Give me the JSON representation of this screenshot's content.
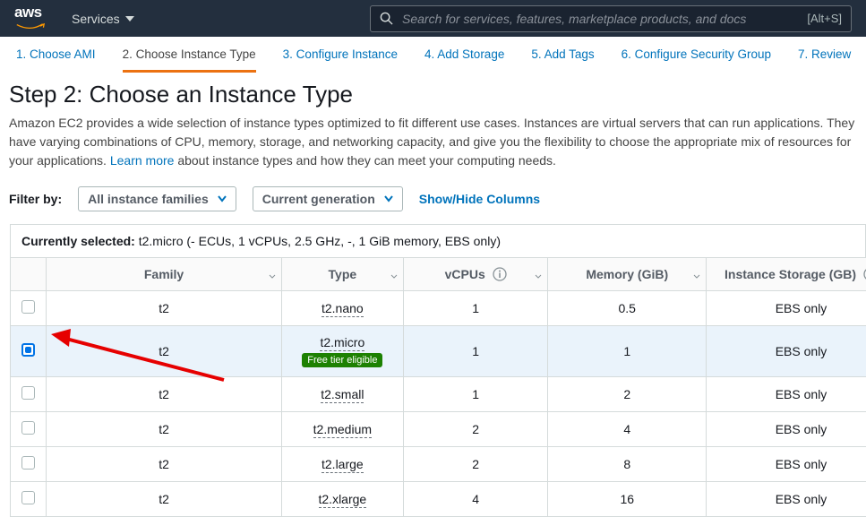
{
  "header": {
    "services_label": "Services",
    "search_placeholder": "Search for services, features, marketplace products, and docs",
    "shortcut": "[Alt+S]"
  },
  "wizard": [
    {
      "label": "1. Choose AMI",
      "active": false
    },
    {
      "label": "2. Choose Instance Type",
      "active": true
    },
    {
      "label": "3. Configure Instance",
      "active": false
    },
    {
      "label": "4. Add Storage",
      "active": false
    },
    {
      "label": "5. Add Tags",
      "active": false
    },
    {
      "label": "6. Configure Security Group",
      "active": false
    },
    {
      "label": "7. Review",
      "active": false
    }
  ],
  "page": {
    "title": "Step 2: Choose an Instance Type",
    "desc_a": "Amazon EC2 provides a wide selection of instance types optimized to fit different use cases. Instances are virtual servers that can run applications. They have varying combinations of CPU, memory, storage, and networking capacity, and give you the flexibility to choose the appropriate mix of resources for your applications. ",
    "learn_more": "Learn more",
    "desc_b": " about instance types and how they can meet your computing needs."
  },
  "filters": {
    "label": "Filter by:",
    "family": "All instance families",
    "generation": "Current generation",
    "columns_link": "Show/Hide Columns"
  },
  "selection": {
    "label": "Currently selected:",
    "value": "t2.micro (- ECUs, 1 vCPUs, 2.5 GHz, -, 1 GiB memory, EBS only)"
  },
  "columns": {
    "family": "Family",
    "type": "Type",
    "vcpus": "vCPUs",
    "memory": "Memory (GiB)",
    "storage": "Instance Storage (GB)"
  },
  "free_tier_badge": "Free tier eligible",
  "rows": [
    {
      "selected": false,
      "family": "t2",
      "type": "t2.nano",
      "vcpus": "1",
      "memory": "0.5",
      "storage": "EBS only",
      "free": false
    },
    {
      "selected": true,
      "family": "t2",
      "type": "t2.micro",
      "vcpus": "1",
      "memory": "1",
      "storage": "EBS only",
      "free": true
    },
    {
      "selected": false,
      "family": "t2",
      "type": "t2.small",
      "vcpus": "1",
      "memory": "2",
      "storage": "EBS only",
      "free": false
    },
    {
      "selected": false,
      "family": "t2",
      "type": "t2.medium",
      "vcpus": "2",
      "memory": "4",
      "storage": "EBS only",
      "free": false
    },
    {
      "selected": false,
      "family": "t2",
      "type": "t2.large",
      "vcpus": "2",
      "memory": "8",
      "storage": "EBS only",
      "free": false
    },
    {
      "selected": false,
      "family": "t2",
      "type": "t2.xlarge",
      "vcpus": "4",
      "memory": "16",
      "storage": "EBS only",
      "free": false
    }
  ]
}
